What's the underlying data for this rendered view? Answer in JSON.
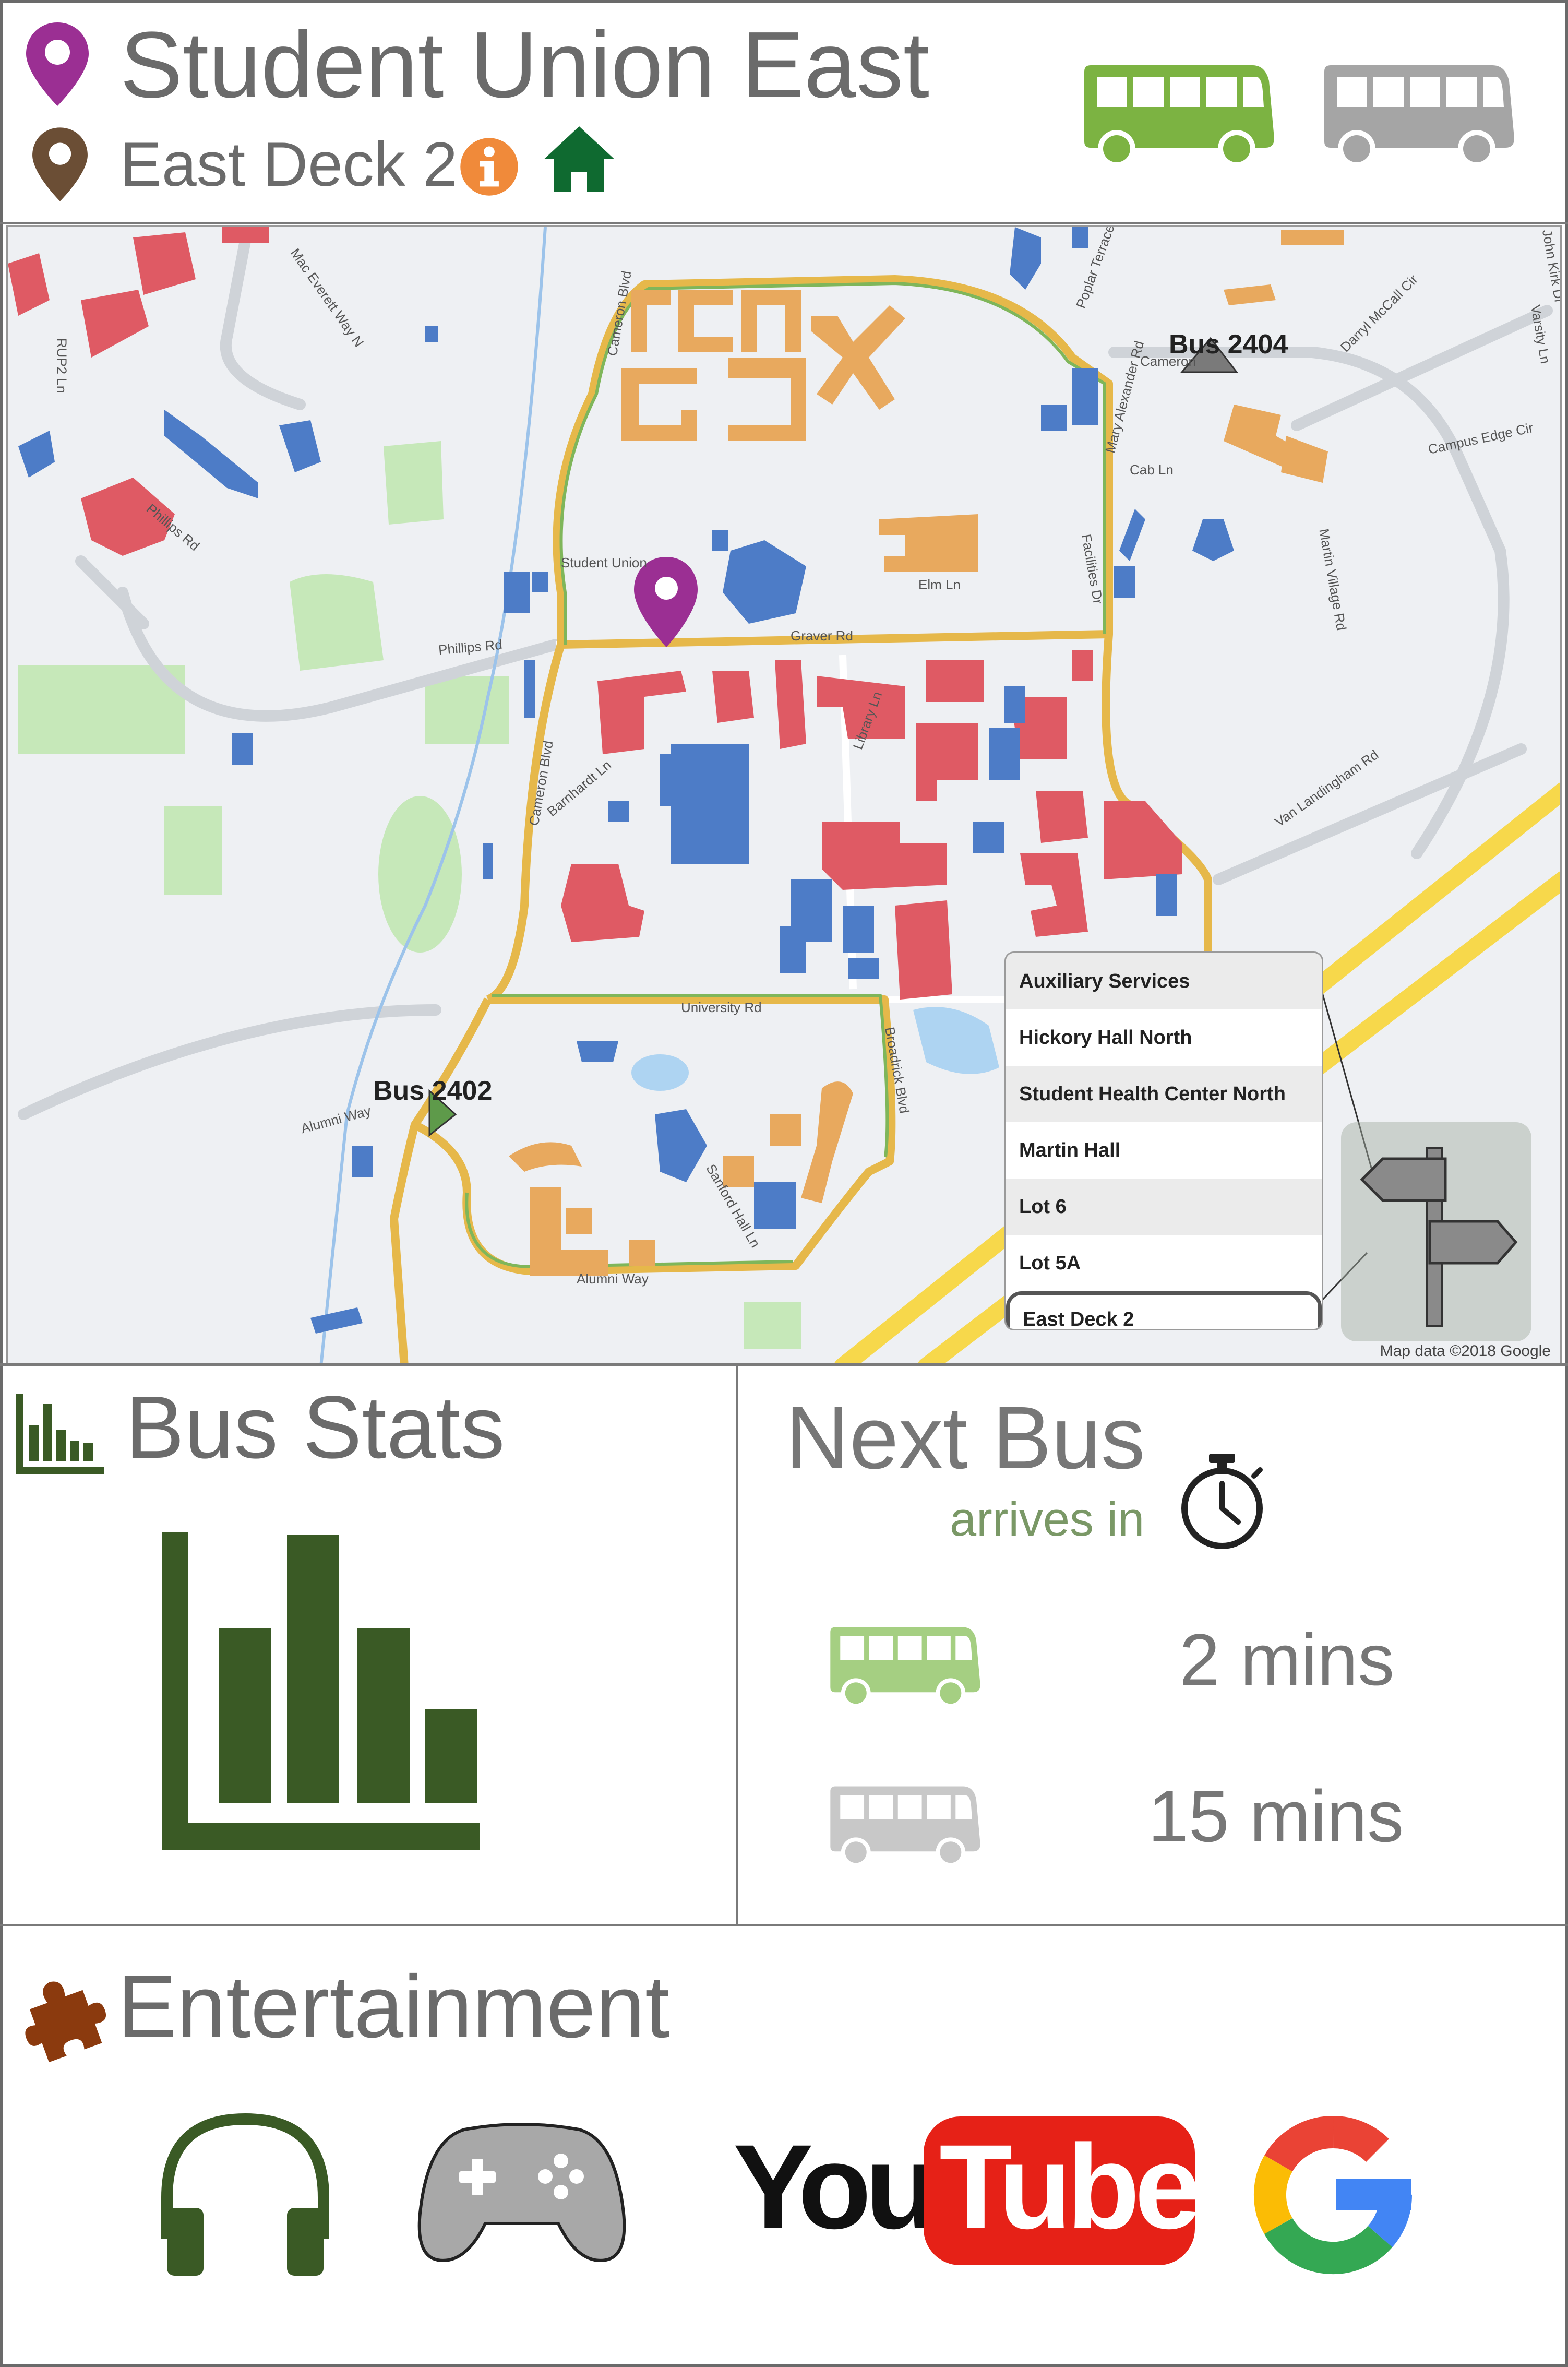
{
  "header": {
    "origin": "Student Union East",
    "destination": "East Deck 2",
    "info_icon": "info-icon",
    "home_icon": "home-icon",
    "bus_icons": [
      "bus-icon-green",
      "bus-icon-gray"
    ]
  },
  "map": {
    "street_labels": [
      "Mac Everett Way N",
      "Phillips Rd",
      "Phillips Rd",
      "RUP2 Ln",
      "Cameron Blvd",
      "Cameron Blvd",
      "Student Union",
      "Elm Ln",
      "Graver Rd",
      "Cab Ln",
      "Cameron",
      "Campus Edge Cir",
      "Darryl McCall Cir",
      "Martin Village Rd",
      "Van Landingham Rd",
      "Library Ln",
      "Barnhardt Ln",
      "University Rd",
      "Broadrick Blvd",
      "Sanford Hall Ln",
      "Alumni Way",
      "Alumni Way",
      "Varsity Ln",
      "John Kirk Dr",
      "Poplar Terrace",
      "Facilities Dr",
      "Mary Alexander Rd"
    ],
    "buses": [
      {
        "label": "Bus 2404"
      },
      {
        "label": "Bus 2402"
      }
    ],
    "dropdown_items": [
      "Auxiliary Services",
      "Hickory Hall North",
      "Student Health Center North",
      "Martin Hall",
      "Lot 6",
      "Lot 5A",
      "East Deck 2"
    ],
    "selected_item": "East Deck 2",
    "copyright": "Map data ©2018 Google",
    "colors": {
      "academic": "#df5a64",
      "housing": "#e8a95e",
      "service": "#4d7cc7",
      "green": "#c6e8b9",
      "route_gold": "#e6b84a",
      "route_green": "#7fb65a",
      "highway": "#f7d84b"
    }
  },
  "bus_stats": {
    "title": "Bus Stats",
    "icon": "bar-chart-icon"
  },
  "next_bus": {
    "title": "Next Bus",
    "subtitle": "arrives in",
    "timer_icon": "stopwatch-icon",
    "arrivals": [
      {
        "bus_icon": "bus-icon-green",
        "eta": "2 mins"
      },
      {
        "bus_icon": "bus-icon-gray",
        "eta": "15 mins"
      }
    ]
  },
  "entertainment": {
    "title": "Entertainment",
    "icon": "puzzle-icon",
    "apps": [
      {
        "name": "headphones-icon"
      },
      {
        "name": "gamepad-icon"
      },
      {
        "name": "youtube-logo",
        "text_you": "You",
        "text_tube": "Tube"
      },
      {
        "name": "google-logo"
      }
    ]
  }
}
